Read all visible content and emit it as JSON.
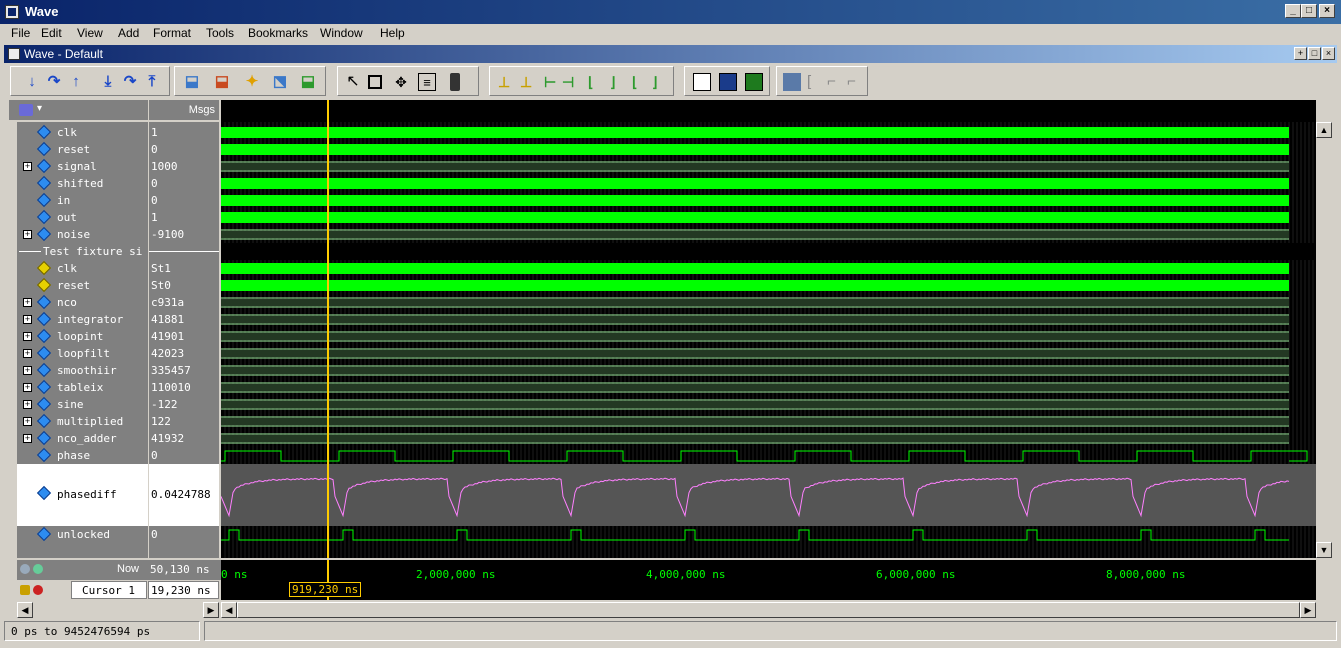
{
  "window": {
    "title": "Wave"
  },
  "menu": [
    "File",
    "Edit",
    "View",
    "Add",
    "Format",
    "Tools",
    "Bookmarks",
    "Window",
    "Help"
  ],
  "subwindow": {
    "title": "Wave - Default"
  },
  "pane_headers": {
    "values": "Msgs"
  },
  "signals": [
    {
      "name": "clk",
      "value": "1",
      "expandable": false,
      "icon": "signal-icon"
    },
    {
      "name": "reset",
      "value": "0",
      "expandable": false,
      "icon": "signal-icon"
    },
    {
      "name": "signal",
      "value": "1000",
      "expandable": true,
      "icon": "signal-icon"
    },
    {
      "name": "shifted",
      "value": "0",
      "expandable": false,
      "icon": "signal-icon"
    },
    {
      "name": "in",
      "value": "0",
      "expandable": false,
      "icon": "signal-icon"
    },
    {
      "name": "out",
      "value": "1",
      "expandable": false,
      "icon": "signal-icon"
    },
    {
      "name": "noise",
      "value": "-9100",
      "expandable": true,
      "icon": "signal-icon"
    },
    {
      "name": "Test fixture si",
      "value": "",
      "group": true
    },
    {
      "name": "clk",
      "value": "St1",
      "expandable": false,
      "icon": "net-icon"
    },
    {
      "name": "reset",
      "value": "St0",
      "expandable": false,
      "icon": "net-icon"
    },
    {
      "name": "nco",
      "value": "c931a",
      "expandable": true,
      "icon": "signal-icon"
    },
    {
      "name": "integrator",
      "value": "41881",
      "expandable": true,
      "icon": "signal-icon"
    },
    {
      "name": "loopint",
      "value": "41901",
      "expandable": true,
      "icon": "signal-icon"
    },
    {
      "name": "loopfilt",
      "value": "42023",
      "expandable": true,
      "icon": "signal-icon"
    },
    {
      "name": "smoothiir",
      "value": "335457",
      "expandable": true,
      "icon": "signal-icon"
    },
    {
      "name": "tableix",
      "value": "110010",
      "expandable": true,
      "icon": "signal-icon"
    },
    {
      "name": "sine",
      "value": "-122",
      "expandable": true,
      "icon": "signal-icon"
    },
    {
      "name": "multiplied",
      "value": "122",
      "expandable": true,
      "icon": "signal-icon"
    },
    {
      "name": "nco_adder",
      "value": "41932",
      "expandable": true,
      "icon": "signal-icon"
    },
    {
      "name": "phase",
      "value": "0",
      "expandable": false,
      "icon": "signal-icon"
    },
    {
      "name": "phasediff",
      "value": "0.0424788",
      "expandable": false,
      "icon": "signal-icon",
      "analog": true
    },
    {
      "name": "unlocked",
      "value": "0",
      "expandable": false,
      "icon": "signal-icon"
    }
  ],
  "timeline": {
    "now_label": "Now",
    "now_value": "50,130 ns",
    "cursor_label": "Cursor 1",
    "cursor_value": "19,230 ns",
    "cursor_marker": "919,230 ns",
    "ticks": [
      "0 ns",
      "2,000,000 ns",
      "4,000,000 ns",
      "6,000,000 ns",
      "8,000,000 ns"
    ]
  },
  "status": {
    "range": "0 ps to 9452476594 ps"
  },
  "colors": {
    "wave_green": "#00ff00",
    "bus_green": "#a0f0a0",
    "cursor": "#ffcc00",
    "analog": "#ff80ff"
  }
}
